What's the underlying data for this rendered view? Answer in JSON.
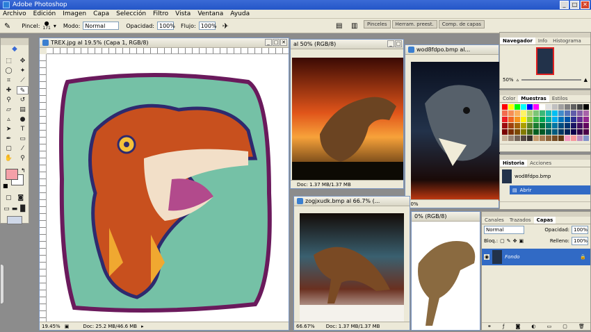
{
  "app": {
    "title": "Adobe Photoshop"
  },
  "menu": [
    "Archivo",
    "Edición",
    "Imagen",
    "Capa",
    "Selección",
    "Filtro",
    "Vista",
    "Ventana",
    "Ayuda"
  ],
  "options": {
    "brush_label": "Pincel:",
    "brush_size": "171",
    "mode_label": "Modo:",
    "mode_value": "Normal",
    "opacity_label": "Opacidad:",
    "opacity_value": "100%",
    "flow_label": "Flujo:",
    "flow_value": "100%",
    "well_tabs": [
      "Pinceles",
      "Herram. preest.",
      "Comp. de capas"
    ]
  },
  "docs": {
    "trex": {
      "title": "TREX.jpg al 19.5% (Capa 1, RGB/8)",
      "zoom": "19.45%",
      "info": "Doc: 25.2 MB/46.6 MB"
    },
    "dino2": {
      "title": "al 50% (RGB/8)",
      "info": "Doc: 1.37 MB/1.37 MB"
    },
    "wod": {
      "title": "wod8fdpo.bmp al...",
      "zoom": "50%"
    },
    "zog": {
      "title": "zogjxudk.bmp al 66.7% (...",
      "zoom": "66.67%",
      "info": "Doc: 1.37 MB/1.37 MB"
    },
    "dino4": {
      "title": "0% (RGB/8)"
    }
  },
  "panels": {
    "navigator": {
      "tabs": [
        "Navegador",
        "Info",
        "Histograma"
      ],
      "zoom": "50%"
    },
    "color": {
      "tabs": [
        "Color",
        "Muestras",
        "Estilos"
      ]
    },
    "history": {
      "tabs": [
        "Historia",
        "Acciones"
      ],
      "snapshot": "wod8fdpo.bmp",
      "step": "Abrir"
    },
    "layers": {
      "tabs": [
        "Canales",
        "Trazados",
        "Capas"
      ],
      "blend": "Normal",
      "opacity_label": "Opacidad:",
      "opacity": "100%",
      "lock_label": "Bloq.:",
      "fill_label": "Relleno:",
      "fill": "100%",
      "layer_name": "Fondo"
    }
  },
  "colors": {
    "accent": "#316ac5",
    "fg_swatch": "#f4a0a8"
  }
}
